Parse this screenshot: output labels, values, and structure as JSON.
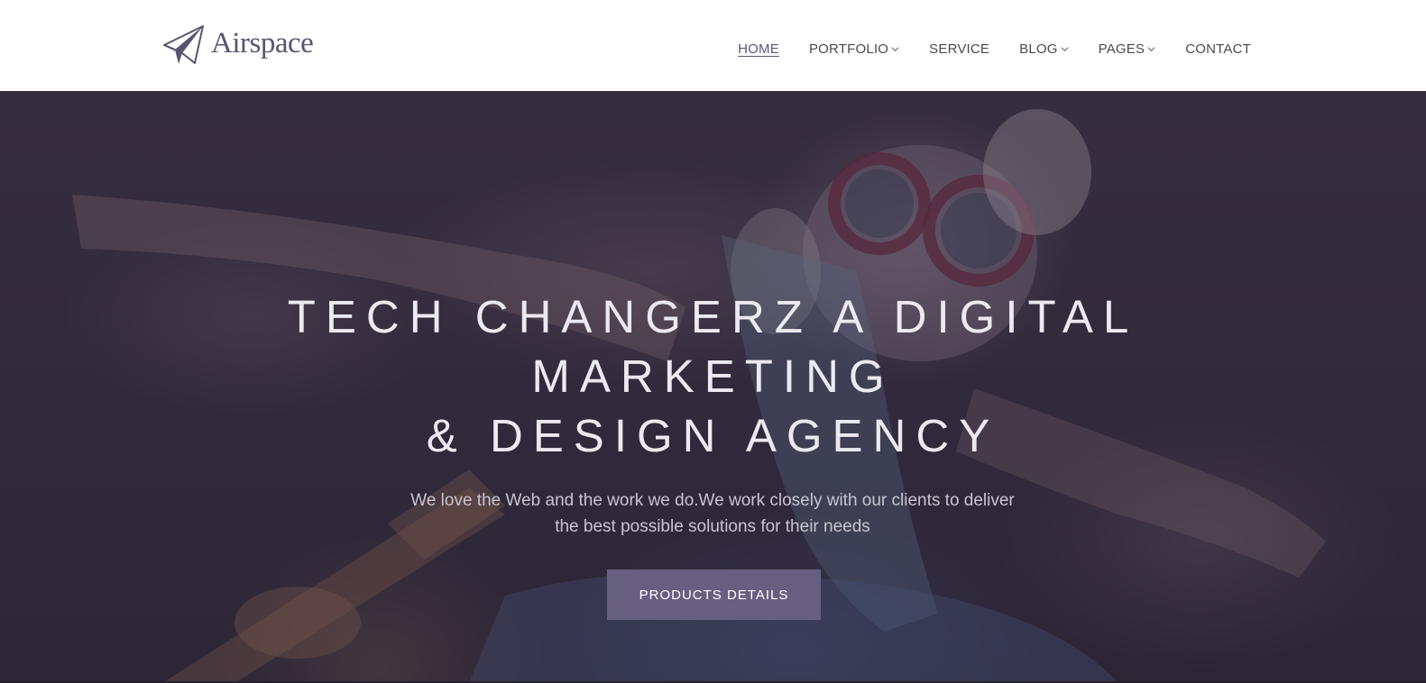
{
  "brand": {
    "name": "Airspace",
    "icon": "paper-plane-icon"
  },
  "nav": {
    "items": [
      {
        "label": "HOME",
        "active": true,
        "dropdown": false
      },
      {
        "label": "PORTFOLIO",
        "active": false,
        "dropdown": true
      },
      {
        "label": "SERVICE",
        "active": false,
        "dropdown": false
      },
      {
        "label": "BLOG",
        "active": false,
        "dropdown": true
      },
      {
        "label": "PAGES",
        "active": false,
        "dropdown": true
      },
      {
        "label": "CONTACT",
        "active": false,
        "dropdown": false
      }
    ]
  },
  "hero": {
    "title_lines": [
      "TECH CHANGERZ A DIGITAL",
      "MARKETING",
      "& DESIGN AGENCY"
    ],
    "subtitle_lines": [
      "We love the Web and the work we do.We work closely with our clients to deliver",
      "the best possible solutions for their needs"
    ],
    "button_label": "PRODUCTS DETAILS"
  },
  "colors": {
    "accent": "#675f7f",
    "nav_active": "#5d557a",
    "header_bg": "#ffffff"
  }
}
